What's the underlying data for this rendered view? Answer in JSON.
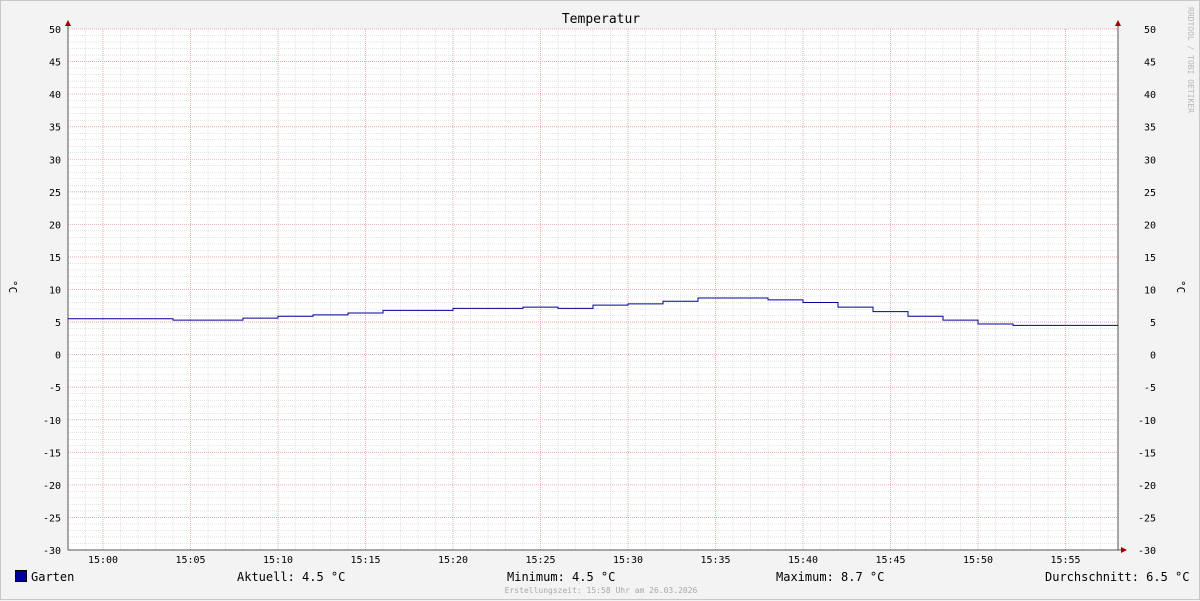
{
  "chart_data": {
    "type": "line",
    "title": "Temperatur",
    "ylabel": "°C",
    "ylim": [
      -30,
      50
    ],
    "yticks": [
      50,
      45,
      40,
      35,
      30,
      25,
      20,
      15,
      10,
      5,
      0,
      -5,
      -10,
      -15,
      -20,
      -25,
      -30
    ],
    "xlim": [
      "14:58",
      "15:58"
    ],
    "xticks": [
      "15:00",
      "15:05",
      "15:10",
      "15:15",
      "15:20",
      "15:25",
      "15:30",
      "15:35",
      "15:40",
      "15:45",
      "15:50",
      "15:55"
    ],
    "grid": true,
    "legend_position": "bottom-left",
    "series": [
      {
        "name": "Garten",
        "color": "#00009c",
        "step": true,
        "x": [
          "14:58",
          "15:04",
          "15:08",
          "15:10",
          "15:12",
          "15:14",
          "15:16",
          "15:20",
          "15:24",
          "15:26",
          "15:28",
          "15:30",
          "15:32",
          "15:34",
          "15:38",
          "15:40",
          "15:42",
          "15:44",
          "15:46",
          "15:48",
          "15:50",
          "15:52",
          "15:58"
        ],
        "y": [
          5.5,
          5.3,
          5.6,
          5.9,
          6.1,
          6.4,
          6.8,
          7.1,
          7.3,
          7.1,
          7.6,
          7.8,
          8.2,
          8.7,
          8.4,
          8.0,
          7.3,
          6.6,
          5.9,
          5.3,
          4.7,
          4.5,
          4.5
        ]
      }
    ]
  },
  "rrdtool_label": "RRDTOOL / TOBI OETIKER",
  "legend": {
    "series_name": "Garten",
    "aktuell": "Aktuell: 4.5 °C",
    "minimum": "Minimum: 4.5 °C",
    "maximum": "Maximum: 8.7 °C",
    "durchschnitt": "Durchschnitt: 6.5 °C"
  },
  "footer": "Erstellungszeit: 15:58 Uhr am 26.03.2026",
  "colors": {
    "major_grid": "#e8a0a0",
    "minor_grid": "#c8c8c8",
    "axis": "#555555",
    "arrow": "#a00000",
    "plot_bg": "#ffffff",
    "page_bg": "#f3f3f3"
  }
}
